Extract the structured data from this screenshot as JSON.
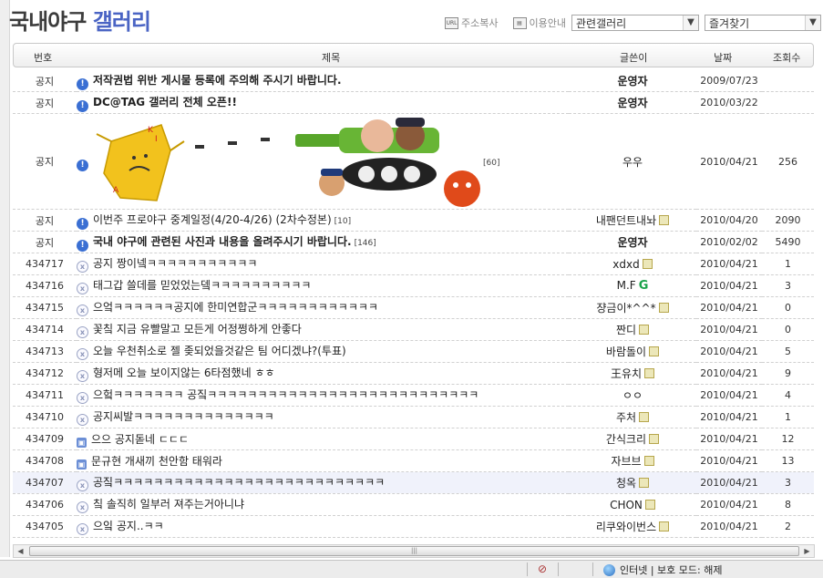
{
  "gallery_title": {
    "part1": "국내야구",
    "part2": "갤러리"
  },
  "toolbar": {
    "address_copy": "주소복사",
    "usage_guide": "이용안내",
    "related_select": "관련갤러리",
    "favorites_select": "즐겨찾기"
  },
  "columns": {
    "num": "번호",
    "subject": "제목",
    "writer": "글쓴이",
    "date": "날짜",
    "hits": "조회수"
  },
  "notices": [
    {
      "num": "공지",
      "subject": "저작권법 위반 게시물 등록에 주의해 주시기 바랍니다.",
      "writer": "운영자",
      "date": "2009/07/23",
      "hits": ""
    },
    {
      "num": "공지",
      "subject": "DC@TAG 갤러리 전체 오픈!!",
      "writer": "운영자",
      "date": "2010/03/22",
      "hits": ""
    }
  ],
  "image_post": {
    "num": "공지",
    "comments": "[60]",
    "writer": "우우",
    "date": "2010/04/21",
    "hits": "256",
    "banner_letters": [
      "K",
      "I",
      "A"
    ]
  },
  "notices2": [
    {
      "num": "공지",
      "subject": "이번주 프로야구 중계일정(4/20-4/26) (2차수정본)",
      "comments": "[10]",
      "writer": "내팬던트내놔",
      "date": "2010/04/20",
      "hits": "2090"
    },
    {
      "num": "공지",
      "subject": "국내 야구에 관련된 사진과 내용을 올려주시기 바랍니다.",
      "comments": "[146]",
      "writer": "운영자",
      "date": "2010/02/02",
      "hits": "5490"
    }
  ],
  "posts": [
    {
      "num": "434717",
      "subject": "공지 짱이넼ㅋㅋㅋㅋㅋㅋㅋㅋㅋㅋㅋ",
      "writer": "xdxd",
      "date": "2010/04/21",
      "hits": "1"
    },
    {
      "num": "434716",
      "subject": "태그갑 쓸데를 믿었었는뎈ㅋㅋㅋㅋㅋㅋㅋㅋㅋㅋ",
      "writer": "M.F",
      "date": "2010/04/21",
      "hits": "3"
    },
    {
      "num": "434715",
      "subject": "으엌ㅋㅋㅋㅋㅋㅋ공지에 한미연합군ㅋㅋㅋㅋㅋㅋㅋㅋㅋㅋㅋㅋ",
      "writer": "쟝금이*^^*",
      "date": "2010/04/21",
      "hits": "0"
    },
    {
      "num": "434714",
      "subject": "꽃칰 지금 유빨말고 모든게 어정쩡하게 안좋다",
      "writer": "짠디",
      "date": "2010/04/21",
      "hits": "0"
    },
    {
      "num": "434713",
      "subject": "오늘 우천취소로 젤 좆되었을것같은 팀 어디겠냐?(투표)",
      "writer": "바람돌이",
      "date": "2010/04/21",
      "hits": "5"
    },
    {
      "num": "434712",
      "subject": "형저메 오늘 보이지않는 6타점했네 ㅎㅎ",
      "writer": "王유치",
      "date": "2010/04/21",
      "hits": "9"
    },
    {
      "num": "434711",
      "subject": "으헠ㅋㅋㅋㅋㅋㅋㅋ 공짘ㅋㅋㅋㅋㅋㅋㅋㅋㅋㅋㅋㅋㅋㅋㅋㅋㅋㅋㅋㅋㅋㅋㅋㅋㅋㅋㅋ",
      "writer": "ㅇㅇ",
      "date": "2010/04/21",
      "hits": "4"
    },
    {
      "num": "434710",
      "subject": "공지씨발ㅋㅋㅋㅋㅋㅋㅋㅋㅋㅋㅋㅋㅋㅋ",
      "writer": "주처",
      "date": "2010/04/21",
      "hits": "1"
    },
    {
      "num": "434709",
      "subject": "으으 공지돋네 ㄷㄷㄷ",
      "writer": "간식크리",
      "date": "2010/04/21",
      "hits": "12"
    },
    {
      "num": "434708",
      "subject": "문규현 개새끼 천안함 태워라",
      "writer": "자브브",
      "date": "2010/04/21",
      "hits": "13"
    },
    {
      "num": "434707",
      "subject": "공짘ㅋㅋㅋㅋㅋㅋㅋㅋㅋㅋㅋㅋㅋㅋㅋㅋㅋㅋㅋㅋㅋㅋㅋㅋㅋㅋㅋ",
      "writer": "청옥",
      "date": "2010/04/21",
      "hits": "3"
    },
    {
      "num": "434706",
      "subject": "칰 솔직히 일부러 져주는거아니냐",
      "writer": "CHON",
      "date": "2010/04/21",
      "hits": "8"
    },
    {
      "num": "434705",
      "subject": "으잌 공지..ㅋㅋ",
      "writer": "리쿠와이번스",
      "date": "2010/04/21",
      "hits": "2"
    }
  ],
  "status": {
    "zone": "인터넷 | 보호 모드: 해제"
  },
  "colors": {
    "accent": "#4a64c4",
    "notice_icon": "#3a6fd3",
    "highlight_row": "#f0f2fb"
  }
}
